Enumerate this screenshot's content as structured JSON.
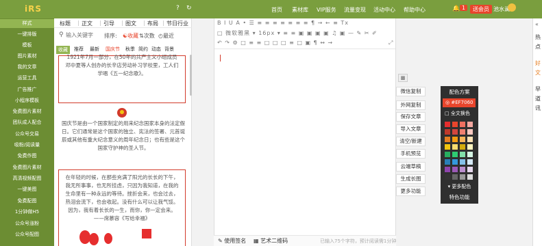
{
  "app": {
    "logo": "iRS"
  },
  "header": {
    "help_icon": "?",
    "refresh_icon": "↻",
    "nav": [
      "首页",
      "素材库",
      "VIP服务",
      "流量变现",
      "活动中心",
      "帮助中心"
    ],
    "notification_count": "1",
    "member_label": "送会员",
    "username": "池水澜"
  },
  "sidebar": {
    "items": [
      "样式",
      "一键排版",
      "模板",
      "图片素材",
      "我的文章",
      "运营工具",
      "广告推广",
      "小程序模板",
      "免费图片素材",
      "团队成人配合",
      "公众号交易",
      "吸粉/阅读量",
      "免费作图",
      "免费图片素材",
      "高清视频配图",
      "一键美图",
      "免费配图",
      "1分钟做H5",
      "公众号涨粉",
      "公众号配图"
    ]
  },
  "panel": {
    "tabs": [
      "标题",
      "正文",
      "引导",
      "图文",
      "布局",
      "节日行业"
    ],
    "search_placeholder": "输入关键字",
    "sort_label": "排序:",
    "sort_options": [
      "收藏",
      "次数",
      "最近"
    ],
    "filters": [
      "收藏",
      "推荐",
      "最新",
      "国庆节",
      "秋季",
      "简约",
      "动态",
      "背景"
    ],
    "cards": [
      {
        "text": "1921年7月一部分，在50年的共产主义小组成员邓中夏等人创办的长辛店劳动补习学校里，工人们学唱《五一纪念歌》。"
      },
      {
        "text": "国庆节是由一个国家制定的用来纪念国家本身的法定假日。它们通常是这个国家的独立、宪法的签署、元首诞辰或其他有重大纪念意义的周年纪念日；也有些是这个国家守护神的圣人节。"
      },
      {
        "text": "在年轻的时候，在那些充满了阳光的长长的下午，我无所事事，也无所挂虑，只因为我知道，在我的生命里有一种永远的等待。挫折会来，也会过去，热泪会流下，也会收起。没有什么可以让我气馁。因为，我有着长长的一生，而你，你一定会来。——席慕容《写给幸福》"
      }
    ]
  },
  "editor": {
    "toolbar_row1": "B I U A • ☰ ≡ ≡ ≡ ≡ ≡ ≡ ≡ ¶ → ← ≡ Tx",
    "toolbar_row2": "□ 微软雅黑 ▾ 16px ▾ ≡ ≡ ▣ ▣ ▣ ▣ ♫ ▣ — ✎ ✂ ✐",
    "toolbar_row3": "↶ ↷ ⚙ □ ≡ ≡ □ □ □ ≡ □ ▣ ¶ ↔ →",
    "footer": {
      "signature": "使用签名",
      "qrcode": "艺术二维码",
      "stats": "已输入75个字符，预计阅读需1分钟"
    }
  },
  "actions": [
    "微信复制",
    "外网复制",
    "保存文章",
    "导入文章",
    "清空/新建",
    "手机预览",
    "云端草稿",
    "生成长图",
    "更多功能"
  ],
  "color_panel": {
    "title": "配色方案",
    "hex": "#EF7060",
    "check_label": "全文换色",
    "more_label": "▾ 更多配色",
    "feature_label": "特色功能",
    "swatches": [
      "#e62e2e",
      "#e8452c",
      "#ef7060",
      "#f4a7a0",
      "#c0392b",
      "#d2463e",
      "#f08070",
      "#f9c8c0",
      "#e67e22",
      "#f39c12",
      "#f7b65a",
      "#fde2b5",
      "#f1c40f",
      "#f7dc6f",
      "#d4ac0d",
      "#fff5c0",
      "#27ae60",
      "#2ecc71",
      "#82e0aa",
      "#d5f5e3",
      "#2980b9",
      "#3498db",
      "#85c1e9",
      "#d6eaf8",
      "#8e44ad",
      "#9b59b6",
      "#bb8fce",
      "#e8daef",
      "#333333",
      "#666666",
      "#999999",
      "#dddddd"
    ]
  },
  "right_edge": {
    "text": [
      "«",
      "热",
      "点",
      "好",
      "文",
      "早",
      "道",
      "讯"
    ]
  }
}
